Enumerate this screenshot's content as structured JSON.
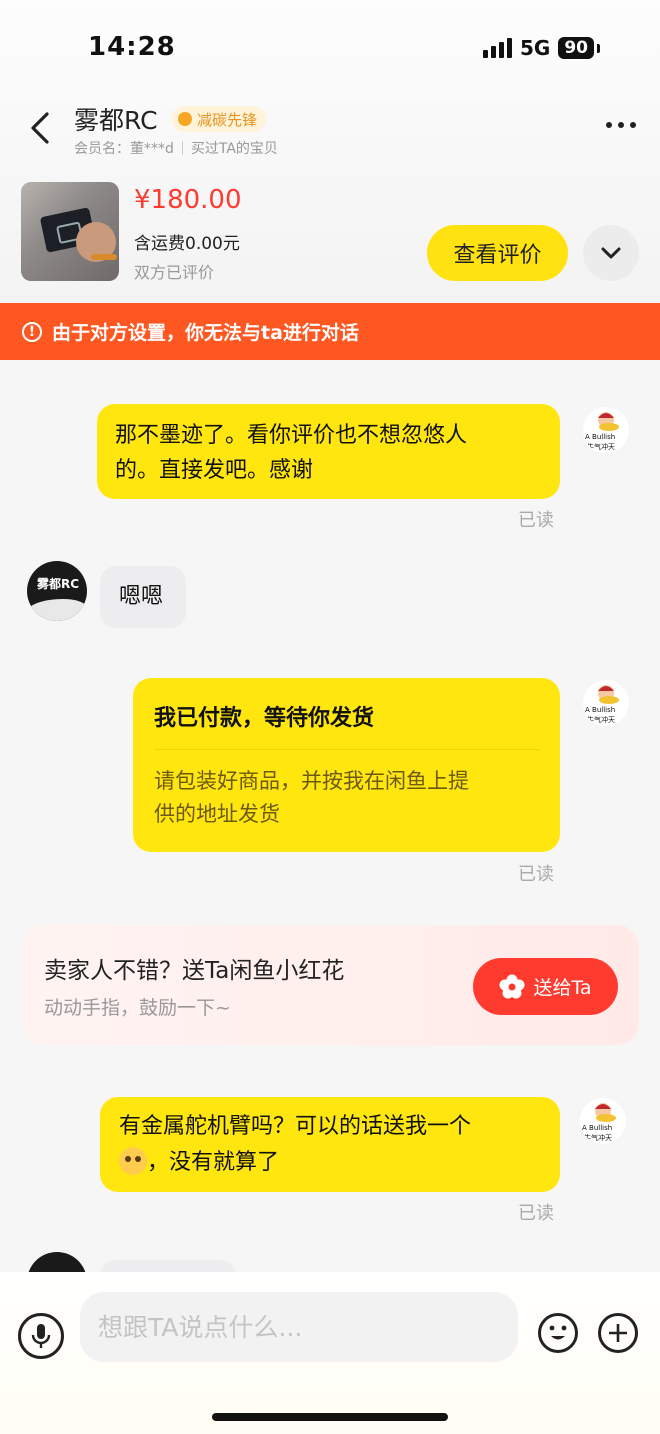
{
  "status_bar": {
    "time": "14:28",
    "network": "5G",
    "battery": "90"
  },
  "header": {
    "shop_name": "雾都RC",
    "badge": "减碳先锋",
    "member": "会员名：董***d",
    "bought": "买过TA的宝贝"
  },
  "product": {
    "price": "¥180.00",
    "shipping": "含运费0.00元",
    "status": "双方已评价",
    "review_button": "查看评价"
  },
  "warning": {
    "icon": "!",
    "text": "由于对方设置，你无法与ta进行对话"
  },
  "messages": {
    "m1": {
      "line1": "那不墨迹了。看你评价也不想忽悠人",
      "line2": "的。直接发吧。感谢",
      "read": "已读"
    },
    "m2": {
      "text": "嗯嗯",
      "avatar_label": "雾都RC"
    },
    "m3": {
      "title": "我已付款，等待你发货",
      "line1": "请包装好商品，并按我在闲鱼上提",
      "line2": "供的地址发货",
      "read": "已读"
    },
    "m4": {
      "line1": "有金属舵机臂吗？可以的话送我一个",
      "line2": "，没有就算了",
      "read": "已读"
    }
  },
  "my_avatar": {
    "line1": "A Bullish",
    "line2": "牛气冲天"
  },
  "flower_card": {
    "title": "卖家人不错？送Ta闲鱼小红花",
    "subtitle": "动动手指，鼓励一下~",
    "button": "送给Ta"
  },
  "composer": {
    "placeholder": "想跟TA说点什么..."
  },
  "colors": {
    "accent_yellow": "#ffe60f",
    "warning_orange": "#ff5722",
    "price_red": "#ff3b30"
  }
}
